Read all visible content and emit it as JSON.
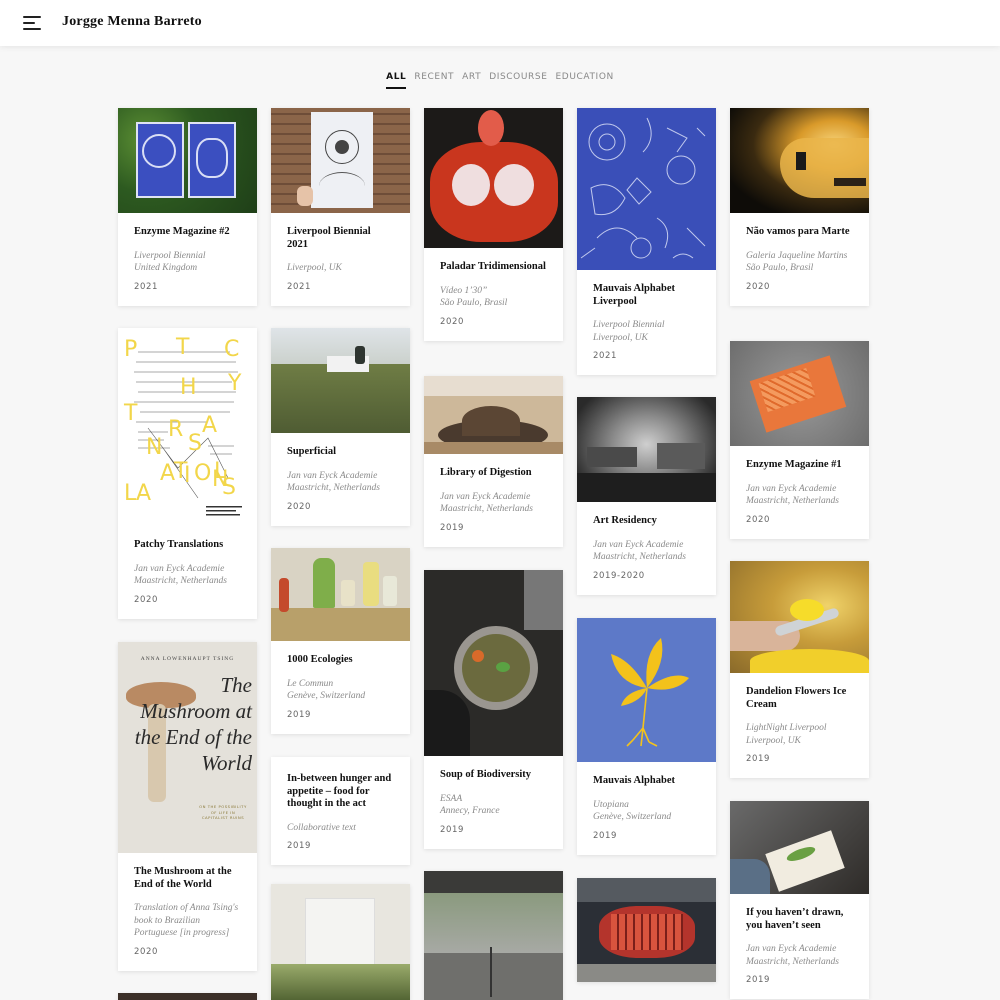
{
  "header": {
    "title": "Jorgge Menna Barreto",
    "menu_icon": "hamburger-menu-icon"
  },
  "filters": [
    "ALL",
    "RECENT",
    "ART",
    "DISCOURSE",
    "EDUCATION"
  ],
  "active_filter": "ALL",
  "cards": [
    {
      "title": "Enzyme Magazine #2",
      "meta": "Liverpool Biennial\nUnited Kingdom",
      "year": "2021"
    },
    {
      "title": "Patchy Translations",
      "meta": "Jan van Eyck Academie\nMaastricht, Netherlands",
      "year": "2020"
    },
    {
      "title": "The Mushroom at the End of the World",
      "meta": "Translation of Anna Tsing's book to Brazilian Portuguese [in progress]",
      "year": "2020"
    },
    {
      "title": "Liverpool Biennial 2021",
      "meta": "Liverpool, UK",
      "year": "2021"
    },
    {
      "title": "Superficial",
      "meta": "Jan van Eyck Academie\nMaastricht, Netherlands",
      "year": "2020"
    },
    {
      "title": "1000 Ecologies",
      "meta": "Le Commun\nGenève, Switzerland",
      "year": "2019"
    },
    {
      "title": "In-between hunger and appetite – food for thought in the act",
      "meta": "Collaborative text",
      "year": "2019"
    },
    {
      "title": "Paladar Tridimensional",
      "meta": "Vídeo 1’30”\nSão Paulo, Brasil",
      "year": "2020"
    },
    {
      "title": "Library of Digestion",
      "meta": "Jan van Eyck Academie\nMaastricht, Netherlands",
      "year": "2019"
    },
    {
      "title": "Soup of Biodiversity",
      "meta": "ESAA\nAnnecy, France",
      "year": "2019"
    },
    {
      "title": "Mauvais Alphabet Liverpool",
      "meta": "Liverpool Biennial\nLiverpool, UK",
      "year": "2021"
    },
    {
      "title": "Art Residency",
      "meta": "Jan van Eyck Academie\nMaastricht, Netherlands",
      "year": "2019-2020"
    },
    {
      "title": "Mauvais Alphabet",
      "meta": "Utopiana\nGenève, Switzerland",
      "year": "2019"
    },
    {
      "title": "Não vamos para Marte",
      "meta": "Galeria Jaqueline Martins\nSão Paulo, Brasil",
      "year": "2020"
    },
    {
      "title": "Enzyme Magazine #1",
      "meta": "Jan van Eyck Academie\nMaastricht, Netherlands",
      "year": "2020"
    },
    {
      "title": "Dandelion Flowers Ice Cream",
      "meta": "LightNight Liverpool\nLiverpool, UK",
      "year": "2019"
    },
    {
      "title": "If you haven’t drawn, you haven’t seen",
      "meta": "Jan van Eyck Academie\nMaastricht, Netherlands",
      "year": "2019"
    }
  ],
  "book_cover": {
    "author": "ANNA LOWENHAUPT TSING",
    "title": "The Mushroom at the End of the World",
    "subtitle": "ON THE POSSIBILITY OF LIFE IN CAPITALIST RUINS"
  },
  "poster_letters": "PATCHY TRANSLATIONS",
  "colors": {
    "accent": "#111111",
    "meta": "#8a8a8a",
    "cyanotype": "#3a4fb8",
    "alphabet_blue": "#5d79c8",
    "flower_yellow": "#f3c21b"
  }
}
